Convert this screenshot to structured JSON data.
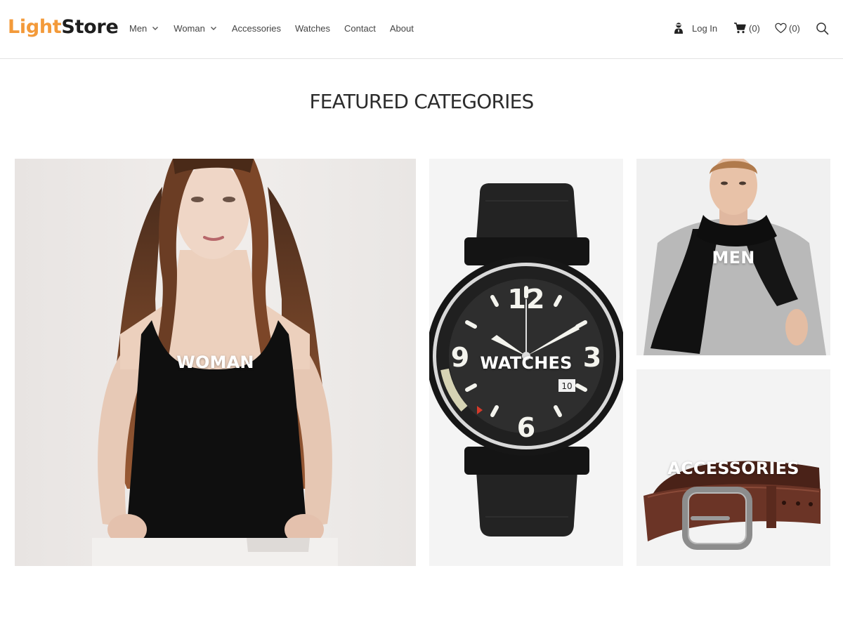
{
  "header": {
    "logo": {
      "part1": "Light",
      "part2": "Store"
    },
    "nav": [
      {
        "label": "Men",
        "has_dropdown": true
      },
      {
        "label": "Woman",
        "has_dropdown": true
      },
      {
        "label": "Accessories",
        "has_dropdown": false
      },
      {
        "label": "Watches",
        "has_dropdown": false
      },
      {
        "label": "Contact",
        "has_dropdown": false
      },
      {
        "label": "About",
        "has_dropdown": false
      }
    ],
    "login_label": "Log In",
    "cart_count": "(0)",
    "wishlist_count": "(0)",
    "icons": [
      "user-icon",
      "cart-icon",
      "heart-icon",
      "search-icon"
    ]
  },
  "section": {
    "title": "FEATURED CATEGORIES"
  },
  "categories": [
    {
      "key": "woman",
      "label": "WOMAN"
    },
    {
      "key": "watches",
      "label": "WATCHES"
    },
    {
      "key": "men",
      "label": "MEN"
    },
    {
      "key": "accessories",
      "label": "ACCESSORIES"
    }
  ],
  "watch_dial": {
    "numerals": [
      "12",
      "3",
      "6",
      "9"
    ],
    "date": "10"
  },
  "colors": {
    "logo_accent": "#f39a3a",
    "logo_dark": "#1e1e1e",
    "text": "#444444",
    "divider": "#e3e3e3"
  }
}
